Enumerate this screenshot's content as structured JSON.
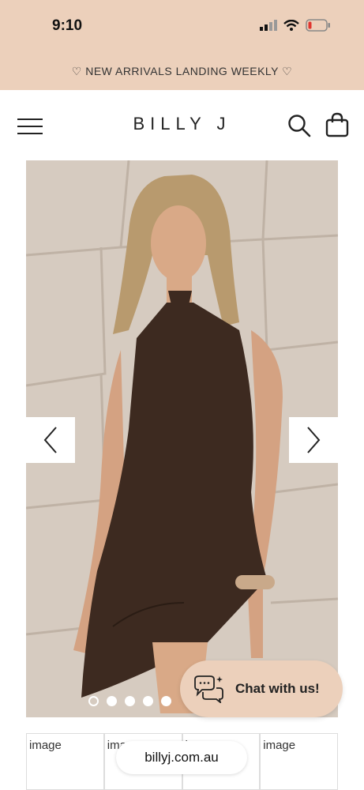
{
  "status_bar": {
    "time": "9:10"
  },
  "announcement": {
    "text": "♡ NEW ARRIVALS LANDING WEEKLY ♡"
  },
  "header": {
    "logo": "BILLY J"
  },
  "carousel": {
    "dots": 5,
    "active_dot": 0
  },
  "chat": {
    "label": "Chat with us!"
  },
  "thumbnails": [
    "image",
    "image",
    "image",
    "image"
  ],
  "browser": {
    "url": "billyj.com.au"
  },
  "colors": {
    "accent": "#ecd0bb",
    "dress": "#3d2a20",
    "wall": "#d8cfc6"
  }
}
